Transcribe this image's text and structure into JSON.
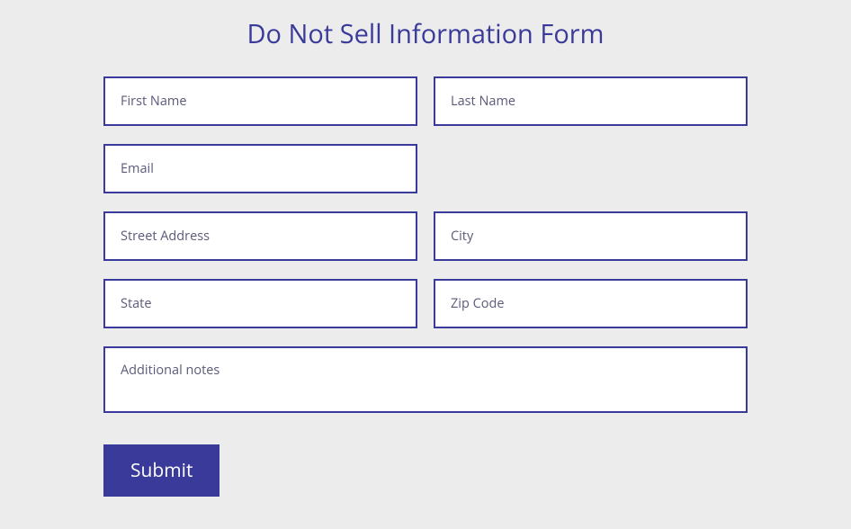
{
  "form": {
    "title": "Do Not Sell Information Form",
    "fields": {
      "first_name": {
        "placeholder": "First Name"
      },
      "last_name": {
        "placeholder": "Last Name"
      },
      "email": {
        "placeholder": "Email"
      },
      "street_address": {
        "placeholder": "Street Address"
      },
      "city": {
        "placeholder": "City"
      },
      "state": {
        "placeholder": "State"
      },
      "zip_code": {
        "placeholder": "Zip Code"
      },
      "additional_notes": {
        "placeholder": "Additional notes"
      }
    },
    "submit_label": "Submit"
  },
  "colors": {
    "primary": "#3a3a9a",
    "background": "#ececec",
    "input_background": "#ffffff"
  }
}
